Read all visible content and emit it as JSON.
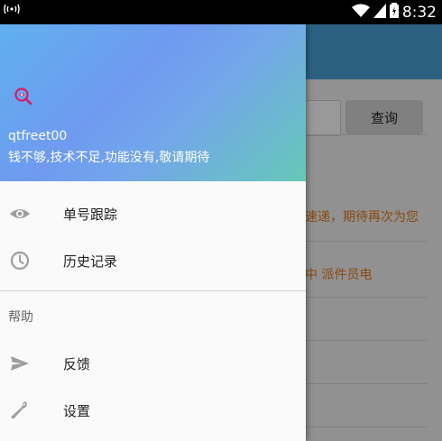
{
  "status_bar": {
    "time": "8:32",
    "left_icon": "wireless-signal-icon"
  },
  "background_app": {
    "query_button": "查询",
    "list_text_1": "速递，期待再次为您",
    "list_text_2": "中 派件员电"
  },
  "drawer": {
    "header": {
      "icon": "search-logo-icon",
      "username": "qtfreet00",
      "motto": "钱不够,技术不足,功能没有,敬请期待"
    },
    "menu": [
      {
        "label": "单号跟踪",
        "icon": "eye-icon"
      },
      {
        "label": "历史记录",
        "icon": "clock-icon"
      }
    ],
    "section_title": "帮助",
    "help_menu": [
      {
        "label": "反馈",
        "icon": "send-icon"
      },
      {
        "label": "设置",
        "icon": "wrench-icon"
      }
    ]
  },
  "colors": {
    "toolbar": "#4aa2d9",
    "accent_text": "#e87a18"
  }
}
